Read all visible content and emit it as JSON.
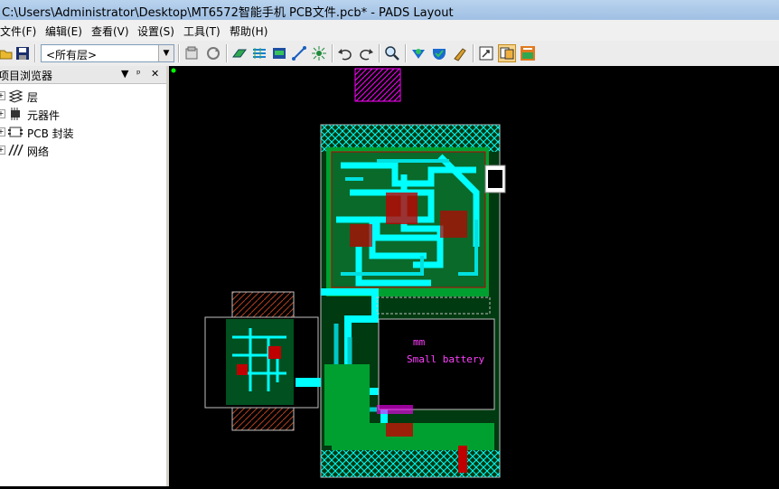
{
  "window": {
    "title": "C:\\Users\\Administrator\\Desktop\\MT6572智能手机 PCB文件.pcb* - PADS Layout"
  },
  "menu": [
    "文件(F)",
    "编辑(E)",
    "查看(V)",
    "设置(S)",
    "工具(T)",
    "帮助(H)"
  ],
  "toolbar": {
    "layer_select": "<所有层>",
    "icons": [
      "open-icon",
      "save-icon",
      "layer-dropdown",
      "properties-icon",
      "redraw-icon",
      "route-icon",
      "copper-icon",
      "drafting-icon",
      "connect-icon",
      "sketch-icon",
      "cluster-icon",
      "undo-icon",
      "redo-icon",
      "zoom-icon",
      "dfm-icon",
      "verify-icon",
      "filter-icon",
      "output-icon",
      "project-icon",
      "pads-icon"
    ]
  },
  "panel": {
    "title": "项目浏览器",
    "items": [
      {
        "label": "层",
        "icon": "layers-icon"
      },
      {
        "label": "元器件",
        "icon": "component-icon"
      },
      {
        "label": "PCB 封装",
        "icon": "footprint-icon"
      },
      {
        "label": "网络",
        "icon": "net-icon"
      }
    ]
  },
  "board": {
    "battery_unit": "mm",
    "battery_label": "Small battery"
  },
  "colors": {
    "cyan": "#00ffff",
    "green": "#00c800",
    "red": "#c80000",
    "magenta": "#ff00ff",
    "board": "#007000"
  }
}
